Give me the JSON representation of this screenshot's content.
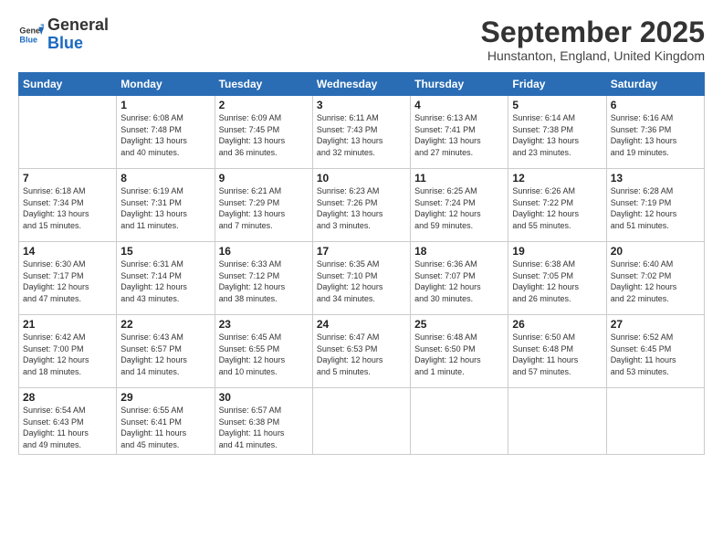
{
  "header": {
    "logo_general": "General",
    "logo_blue": "Blue",
    "month_title": "September 2025",
    "subtitle": "Hunstanton, England, United Kingdom"
  },
  "weekdays": [
    "Sunday",
    "Monday",
    "Tuesday",
    "Wednesday",
    "Thursday",
    "Friday",
    "Saturday"
  ],
  "weeks": [
    [
      {
        "day": "",
        "info": ""
      },
      {
        "day": "1",
        "info": "Sunrise: 6:08 AM\nSunset: 7:48 PM\nDaylight: 13 hours\nand 40 minutes."
      },
      {
        "day": "2",
        "info": "Sunrise: 6:09 AM\nSunset: 7:45 PM\nDaylight: 13 hours\nand 36 minutes."
      },
      {
        "day": "3",
        "info": "Sunrise: 6:11 AM\nSunset: 7:43 PM\nDaylight: 13 hours\nand 32 minutes."
      },
      {
        "day": "4",
        "info": "Sunrise: 6:13 AM\nSunset: 7:41 PM\nDaylight: 13 hours\nand 27 minutes."
      },
      {
        "day": "5",
        "info": "Sunrise: 6:14 AM\nSunset: 7:38 PM\nDaylight: 13 hours\nand 23 minutes."
      },
      {
        "day": "6",
        "info": "Sunrise: 6:16 AM\nSunset: 7:36 PM\nDaylight: 13 hours\nand 19 minutes."
      }
    ],
    [
      {
        "day": "7",
        "info": "Sunrise: 6:18 AM\nSunset: 7:34 PM\nDaylight: 13 hours\nand 15 minutes."
      },
      {
        "day": "8",
        "info": "Sunrise: 6:19 AM\nSunset: 7:31 PM\nDaylight: 13 hours\nand 11 minutes."
      },
      {
        "day": "9",
        "info": "Sunrise: 6:21 AM\nSunset: 7:29 PM\nDaylight: 13 hours\nand 7 minutes."
      },
      {
        "day": "10",
        "info": "Sunrise: 6:23 AM\nSunset: 7:26 PM\nDaylight: 13 hours\nand 3 minutes."
      },
      {
        "day": "11",
        "info": "Sunrise: 6:25 AM\nSunset: 7:24 PM\nDaylight: 12 hours\nand 59 minutes."
      },
      {
        "day": "12",
        "info": "Sunrise: 6:26 AM\nSunset: 7:22 PM\nDaylight: 12 hours\nand 55 minutes."
      },
      {
        "day": "13",
        "info": "Sunrise: 6:28 AM\nSunset: 7:19 PM\nDaylight: 12 hours\nand 51 minutes."
      }
    ],
    [
      {
        "day": "14",
        "info": "Sunrise: 6:30 AM\nSunset: 7:17 PM\nDaylight: 12 hours\nand 47 minutes."
      },
      {
        "day": "15",
        "info": "Sunrise: 6:31 AM\nSunset: 7:14 PM\nDaylight: 12 hours\nand 43 minutes."
      },
      {
        "day": "16",
        "info": "Sunrise: 6:33 AM\nSunset: 7:12 PM\nDaylight: 12 hours\nand 38 minutes."
      },
      {
        "day": "17",
        "info": "Sunrise: 6:35 AM\nSunset: 7:10 PM\nDaylight: 12 hours\nand 34 minutes."
      },
      {
        "day": "18",
        "info": "Sunrise: 6:36 AM\nSunset: 7:07 PM\nDaylight: 12 hours\nand 30 minutes."
      },
      {
        "day": "19",
        "info": "Sunrise: 6:38 AM\nSunset: 7:05 PM\nDaylight: 12 hours\nand 26 minutes."
      },
      {
        "day": "20",
        "info": "Sunrise: 6:40 AM\nSunset: 7:02 PM\nDaylight: 12 hours\nand 22 minutes."
      }
    ],
    [
      {
        "day": "21",
        "info": "Sunrise: 6:42 AM\nSunset: 7:00 PM\nDaylight: 12 hours\nand 18 minutes."
      },
      {
        "day": "22",
        "info": "Sunrise: 6:43 AM\nSunset: 6:57 PM\nDaylight: 12 hours\nand 14 minutes."
      },
      {
        "day": "23",
        "info": "Sunrise: 6:45 AM\nSunset: 6:55 PM\nDaylight: 12 hours\nand 10 minutes."
      },
      {
        "day": "24",
        "info": "Sunrise: 6:47 AM\nSunset: 6:53 PM\nDaylight: 12 hours\nand 5 minutes."
      },
      {
        "day": "25",
        "info": "Sunrise: 6:48 AM\nSunset: 6:50 PM\nDaylight: 12 hours\nand 1 minute."
      },
      {
        "day": "26",
        "info": "Sunrise: 6:50 AM\nSunset: 6:48 PM\nDaylight: 11 hours\nand 57 minutes."
      },
      {
        "day": "27",
        "info": "Sunrise: 6:52 AM\nSunset: 6:45 PM\nDaylight: 11 hours\nand 53 minutes."
      }
    ],
    [
      {
        "day": "28",
        "info": "Sunrise: 6:54 AM\nSunset: 6:43 PM\nDaylight: 11 hours\nand 49 minutes."
      },
      {
        "day": "29",
        "info": "Sunrise: 6:55 AM\nSunset: 6:41 PM\nDaylight: 11 hours\nand 45 minutes."
      },
      {
        "day": "30",
        "info": "Sunrise: 6:57 AM\nSunset: 6:38 PM\nDaylight: 11 hours\nand 41 minutes."
      },
      {
        "day": "",
        "info": ""
      },
      {
        "day": "",
        "info": ""
      },
      {
        "day": "",
        "info": ""
      },
      {
        "day": "",
        "info": ""
      }
    ]
  ]
}
